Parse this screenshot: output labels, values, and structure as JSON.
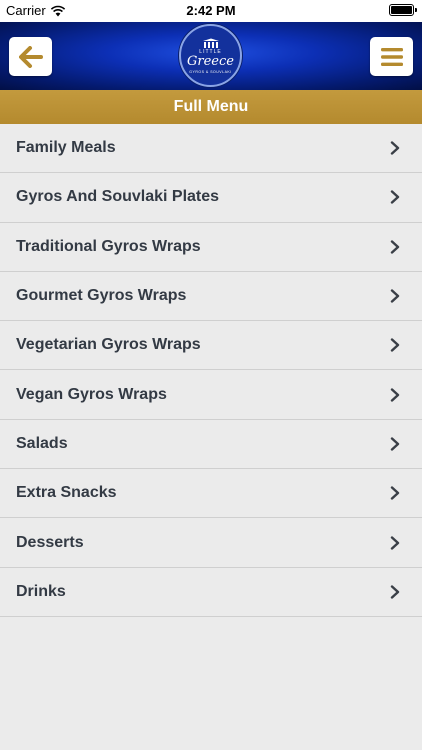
{
  "status_bar": {
    "carrier": "Carrier",
    "time": "2:42 PM"
  },
  "header": {
    "logo": {
      "top_text": "LITTLE",
      "brand": "Greece",
      "sub_text": "GYROS & SOUVLAKI"
    },
    "back_icon": "arrow-left-icon",
    "menu_icon": "hamburger-icon"
  },
  "page_title": "Full Menu",
  "categories": [
    "Family Meals",
    "Gyros And Souvlaki Plates",
    "Traditional Gyros Wraps",
    "Gourmet Gyros Wraps",
    "Vegetarian Gyros Wraps",
    "Vegan Gyros Wraps",
    "Salads",
    "Extra Snacks",
    "Desserts",
    "Drinks"
  ],
  "colors": {
    "accent_gold": "#b48a2e",
    "header_blue": "#0c2fb5",
    "background": "#ebebeb",
    "text": "#333a44"
  }
}
